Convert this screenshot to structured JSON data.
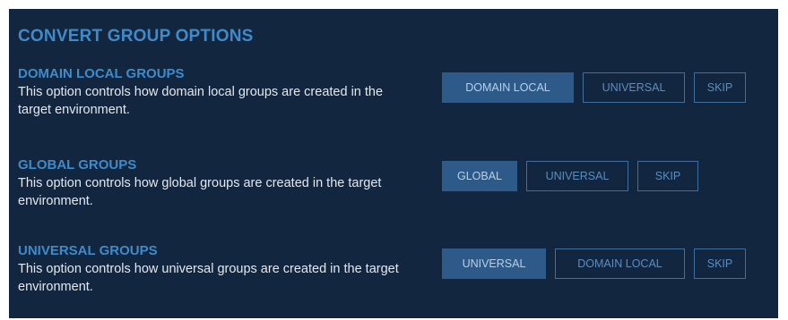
{
  "panel": {
    "title": "CONVERT GROUP OPTIONS"
  },
  "sections": [
    {
      "title": "DOMAIN LOCAL GROUPS",
      "description": "This option controls how domain local groups are created in the target environment.",
      "options": [
        "DOMAIN LOCAL",
        "UNIVERSAL",
        "SKIP"
      ],
      "selected": "DOMAIN LOCAL"
    },
    {
      "title": "GLOBAL GROUPS",
      "description": "This option controls how global groups are created in the target environment.",
      "options": [
        "GLOBAL",
        "UNIVERSAL",
        "SKIP"
      ],
      "selected": "GLOBAL"
    },
    {
      "title": "UNIVERSAL GROUPS",
      "description": "This option controls how universal groups are created in the target environment.",
      "options": [
        "UNIVERSAL",
        "DOMAIN LOCAL",
        "SKIP"
      ],
      "selected": "UNIVERSAL"
    }
  ],
  "colors": {
    "panel_background": "#122640",
    "heading": "#3f8bc9",
    "body_text": "#e3e8ef",
    "button_border": "#3e6f9f",
    "button_text": "#5b8dbf",
    "selected_background": "#2d5a89",
    "selected_text": "#b8d0e8"
  }
}
